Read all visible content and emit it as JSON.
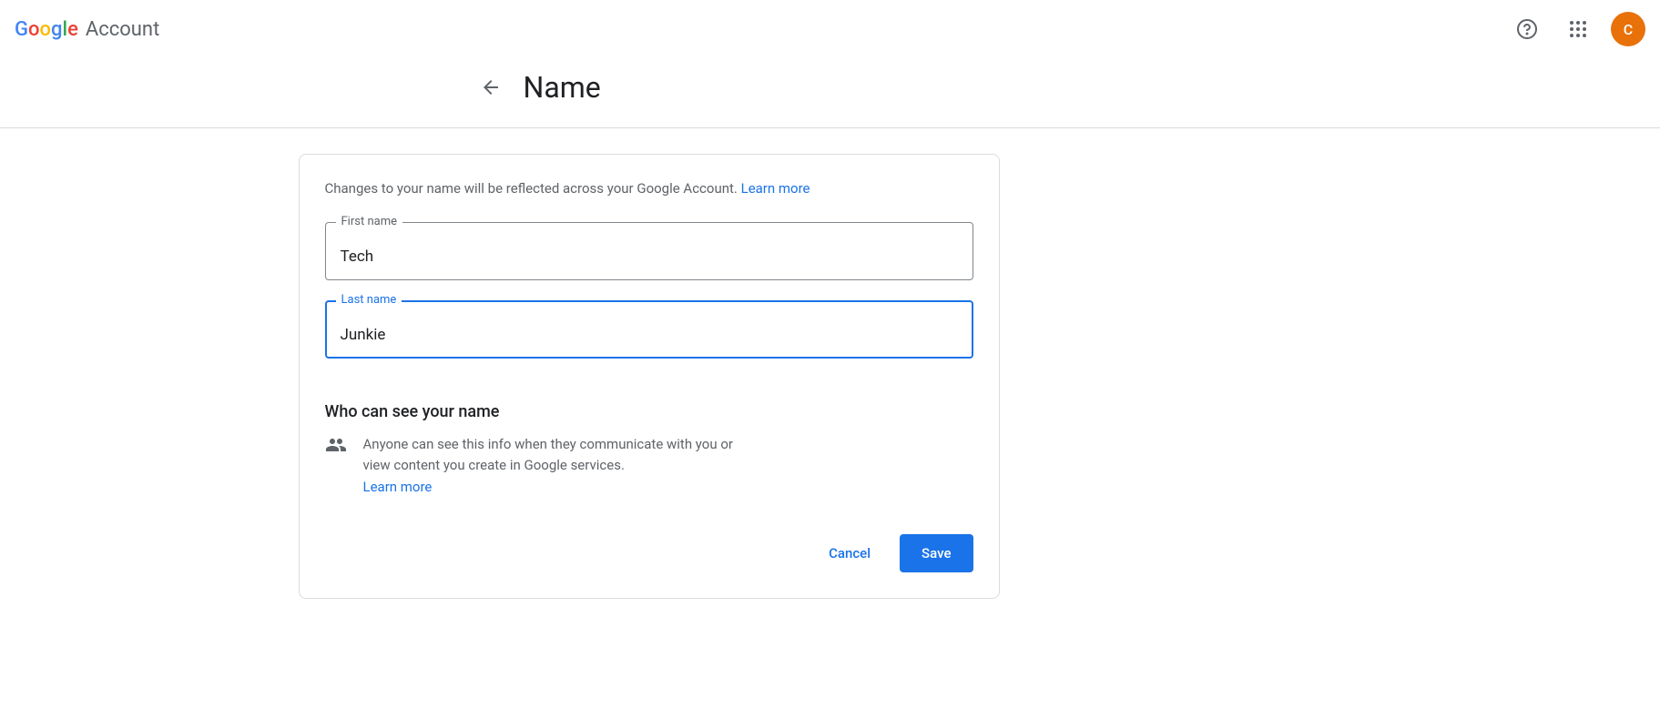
{
  "header": {
    "product": "Account",
    "avatarInitial": "C"
  },
  "page": {
    "title": "Name"
  },
  "form": {
    "introText": "Changes to your name will be reflected across your Google Account. ",
    "introLink": "Learn more",
    "firstNameLabel": "First name",
    "firstNameValue": "Tech",
    "lastNameLabel": "Last name",
    "lastNameValue": "Junkie"
  },
  "visibility": {
    "heading": "Who can see your name",
    "body": "Anyone can see this info when they communicate with you or view content you create in Google services.",
    "link": "Learn more"
  },
  "actions": {
    "cancel": "Cancel",
    "save": "Save"
  }
}
